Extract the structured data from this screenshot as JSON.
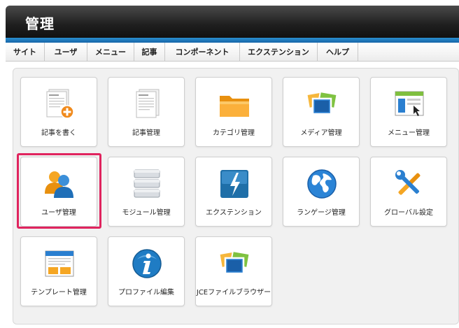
{
  "header": {
    "title": "管理"
  },
  "menu": {
    "items": [
      {
        "label": "サイト"
      },
      {
        "label": "ユーザ"
      },
      {
        "label": "メニュー"
      },
      {
        "label": "記事"
      },
      {
        "label": "コンポーネント"
      },
      {
        "label": "エクステンション"
      },
      {
        "label": "ヘルプ"
      }
    ]
  },
  "tiles": [
    {
      "label": "記事を書く",
      "icon": "article-add-icon"
    },
    {
      "label": "記事管理",
      "icon": "article-icon"
    },
    {
      "label": "カテゴリ管理",
      "icon": "folder-icon"
    },
    {
      "label": "メディア管理",
      "icon": "media-icon"
    },
    {
      "label": "メニュー管理",
      "icon": "menu-window-icon"
    },
    {
      "label": "ユーザ管理",
      "icon": "users-icon",
      "highlighted": true
    },
    {
      "label": "モジュール管理",
      "icon": "modules-icon"
    },
    {
      "label": "エクステンション",
      "icon": "extension-bolt-icon"
    },
    {
      "label": "ランゲージ管理",
      "icon": "globe-icon"
    },
    {
      "label": "グローバル設定",
      "icon": "tools-icon"
    },
    {
      "label": "テンプレート管理",
      "icon": "template-icon"
    },
    {
      "label": "プロファイル編集",
      "icon": "info-icon"
    },
    {
      "label": "JCEファイルブラウザー",
      "icon": "file-browser-icon"
    }
  ],
  "colors": {
    "highlight": "#e0245e",
    "accent": "#1f7cc4",
    "header": "#1f1f1f"
  }
}
